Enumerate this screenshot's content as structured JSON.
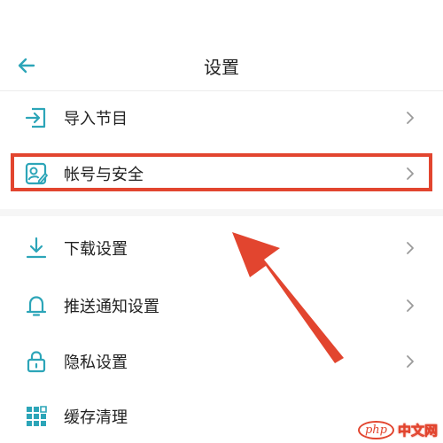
{
  "header": {
    "title": "设置",
    "back_icon": "arrow-left-icon"
  },
  "menu": {
    "items": [
      {
        "label": "导入节目",
        "icon": "import-icon"
      },
      {
        "label": "帐号与安全",
        "icon": "account-security-icon"
      },
      {
        "label": "下载设置",
        "icon": "download-icon"
      },
      {
        "label": "推送通知设置",
        "icon": "bell-icon"
      },
      {
        "label": "隐私设置",
        "icon": "lock-icon"
      },
      {
        "label": "缓存清理",
        "icon": "cache-grid-icon"
      }
    ]
  },
  "colors": {
    "accent": "#2ca5b8",
    "highlight": "#e2452f"
  },
  "watermark": {
    "logo": "php",
    "text": "中文网"
  }
}
